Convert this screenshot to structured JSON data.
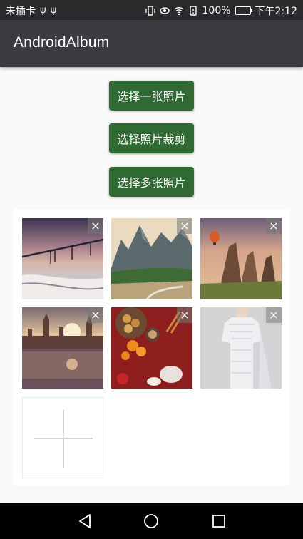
{
  "status_bar": {
    "carrier": "未插卡",
    "battery_percent": "100%",
    "time": "下午2:12",
    "battery_level": 1.0
  },
  "app_bar": {
    "title": "AndroidAlbum"
  },
  "buttons": {
    "select_one": "选择一张照片",
    "select_crop": "选择照片裁剪",
    "select_multiple": "选择多张照片"
  },
  "photos": [
    {
      "name": "bridge-sunset-photo"
    },
    {
      "name": "mountain-valley-photo"
    },
    {
      "name": "rock-spires-balloon-photo"
    },
    {
      "name": "castle-river-photo"
    },
    {
      "name": "food-table-photo"
    },
    {
      "name": "lace-dress-photo"
    }
  ],
  "remove_icon": "×",
  "colors": {
    "button": "#2f6a33",
    "app_bar": "#3a3c3f",
    "status_bar": "#2a2b2d",
    "battery": "#3cd44a"
  }
}
